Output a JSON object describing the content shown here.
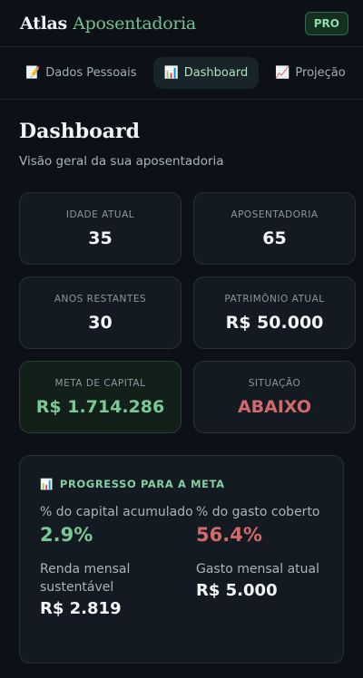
{
  "header": {
    "brand_part1": "Atlas",
    "brand_part2": "Aposentadoria",
    "badge": "PRO"
  },
  "tabs": [
    {
      "icon": "📝",
      "label": "Dados Pessoais",
      "active": false
    },
    {
      "icon": "📊",
      "label": "Dashboard",
      "active": true
    },
    {
      "icon": "📈",
      "label": "Projeção",
      "active": false
    }
  ],
  "page": {
    "title": "Dashboard",
    "subtitle": "Visão geral da sua aposentadoria"
  },
  "cards": [
    {
      "label": "IDADE ATUAL",
      "value": "35"
    },
    {
      "label": "APOSENTADORIA",
      "value": "65"
    },
    {
      "label": "ANOS RESTANTES",
      "value": "30"
    },
    {
      "label": "PATRIMÔNIO ATUAL",
      "value": "R$ 50.000"
    },
    {
      "label": "META DE CAPITAL",
      "value": "R$ 1.714.286"
    },
    {
      "label": "SITUAÇÃO",
      "value": "ABAIXO"
    }
  ],
  "progress": {
    "icon": "📊",
    "title": "PROGRESSO PARA A META",
    "stats": [
      {
        "label": "% do capital acumulado",
        "value": "2.9%"
      },
      {
        "label": "% do gasto coberto",
        "value": "56.4%"
      },
      {
        "label": "Renda mensal sustentável",
        "value": "R$ 2.819"
      },
      {
        "label": "Gasto mensal atual",
        "value": "R$ 5.000"
      }
    ]
  },
  "colors": {
    "background": "#0d1117",
    "accent_green": "#7ac995",
    "alert_red": "#d36a6a"
  }
}
